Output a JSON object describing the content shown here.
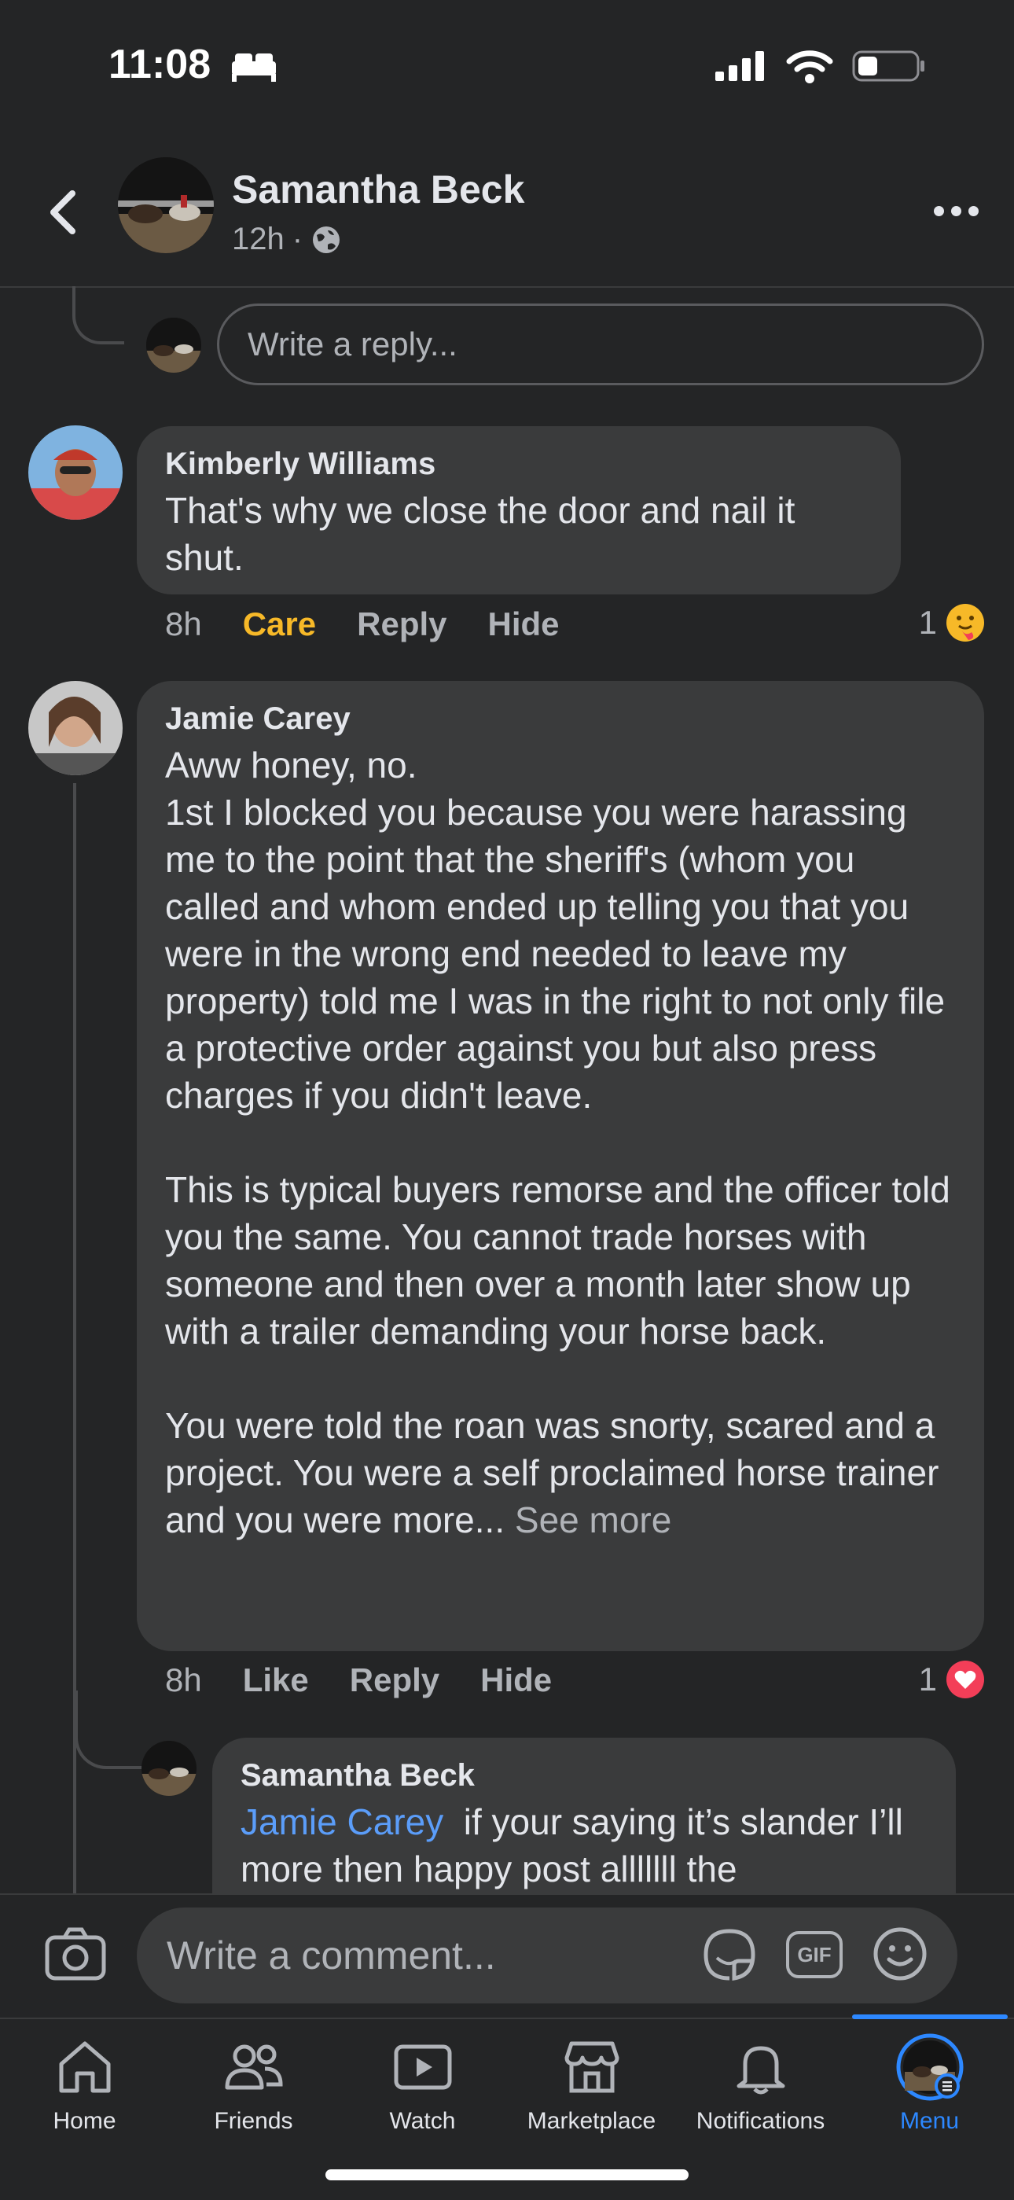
{
  "status": {
    "time": "11:08"
  },
  "header": {
    "name": "Samantha Beck",
    "time": "12h",
    "separator": "·"
  },
  "reply_box": {
    "placeholder": "Write a reply..."
  },
  "comments": [
    {
      "author": "Kimberly Williams",
      "text": "That's why we close the door and nail it shut.",
      "time": "8h",
      "reaction_label": "Care",
      "reply_label": "Reply",
      "hide_label": "Hide",
      "reaction_count": "1",
      "reaction_icon": "care-emoji-icon"
    },
    {
      "author": "Jamie Carey",
      "text": "Aww honey, no.\n1st I blocked you because you were harassing me to the point that the sheriff's (whom you called and whom ended up telling you that you were in the wrong end needed to leave my property) told me I was in the right to not only file a protective order against you but also press charges if you didn't leave.\n\nThis is typical buyers remorse and the officer told you the same. You cannot trade horses with someone and then over a month later show up with a trailer demanding your horse back.\n\nYou were told the roan was snorty, scared and a project. You were a self proclaimed horse trainer and you were more...",
      "see_more": " See more",
      "time": "8h",
      "like_label": "Like",
      "reply_label": "Reply",
      "hide_label": "Hide",
      "reaction_count": "1",
      "reaction_icon": "love-heart-icon"
    }
  ],
  "reply": {
    "author": "Samantha Beck",
    "mention": "Jamie Carey",
    "text": "  if your saying it’s slander I’ll more then happy post alllllll the"
  },
  "composer": {
    "placeholder": "Write a comment...",
    "gif_label": "GIF"
  },
  "tabs": [
    {
      "label": "Home",
      "icon": "home-icon"
    },
    {
      "label": "Friends",
      "icon": "friends-icon"
    },
    {
      "label": "Watch",
      "icon": "watch-icon"
    },
    {
      "label": "Marketplace",
      "icon": "marketplace-icon"
    },
    {
      "label": "Notifications",
      "icon": "bell-icon"
    },
    {
      "label": "Menu",
      "icon": "menu-avatar-icon",
      "active": true
    }
  ],
  "colors": {
    "background": "#242526",
    "bubble": "#3a3b3c",
    "care": "#f7b928",
    "link": "#5b9df9",
    "active_tab": "#2d88ff",
    "love": "#f33e58"
  }
}
